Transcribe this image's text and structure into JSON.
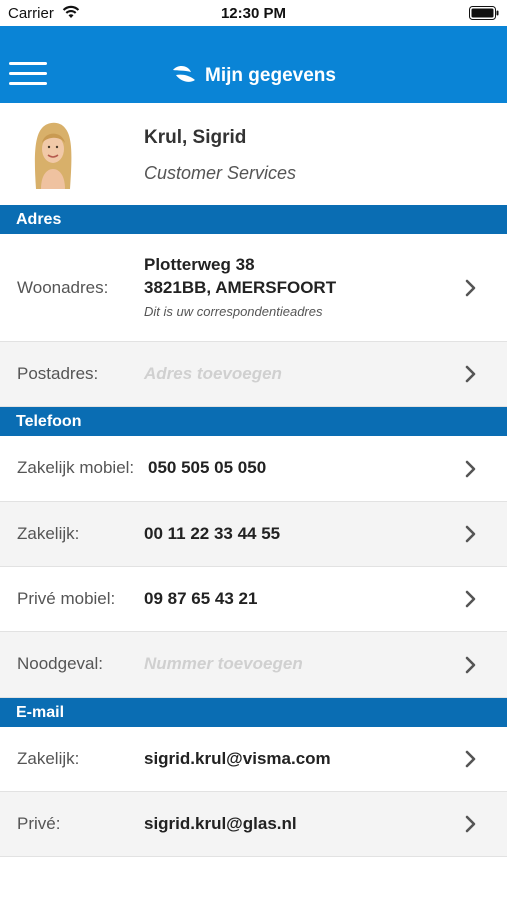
{
  "status_bar": {
    "carrier": "Carrier",
    "time": "12:30 PM"
  },
  "nav": {
    "title": "Mijn gegevens",
    "color": "#0a84d6"
  },
  "profile": {
    "name": "Krul, Sigrid",
    "role": "Customer Services"
  },
  "sections": {
    "adres": "Adres",
    "telefoon": "Telefoon",
    "email": "E-mail"
  },
  "address": {
    "home_label": "Woonadres:",
    "home_line1": "Plotterweg 38",
    "home_line2": "3821BB, AMERSFOORT",
    "home_note": "Dit is uw correspondentieadres",
    "postal_label": "Postadres:",
    "postal_placeholder": "Adres toevoegen"
  },
  "phone": {
    "work_mobile_label": "Zakelijk mobiel:",
    "work_mobile_value": "050 505 05 050",
    "work_label": "Zakelijk:",
    "work_value": "00 11 22 33 44 55",
    "private_mobile_label": "Privé mobiel:",
    "private_mobile_value": "09 87 65 43 21",
    "emergency_label": "Noodgeval:",
    "emergency_placeholder": "Nummer toevoegen"
  },
  "email": {
    "work_label": "Zakelijk:",
    "work_value": "sigrid.krul@visma.com",
    "private_label": "Privé:",
    "private_value": "sigrid.krul@glas.nl"
  },
  "icons": {
    "menu": "menu-icon",
    "logo": "visma-logo-icon",
    "chevron": "chevron-right-icon",
    "wifi": "wifi-icon",
    "battery": "battery-icon"
  }
}
